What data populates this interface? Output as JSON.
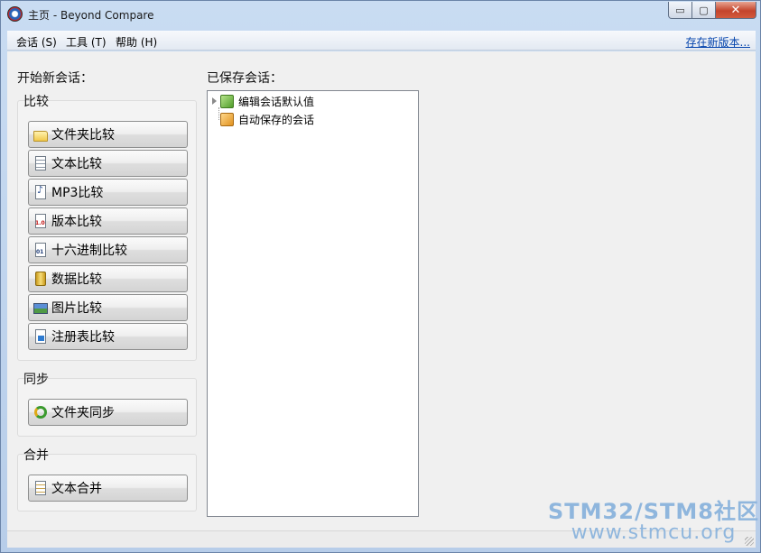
{
  "window": {
    "title": "主页 - Beyond Compare",
    "minimize": "▭",
    "maximize": "▢",
    "close": "✕"
  },
  "menu": {
    "items": [
      "会话 (S)",
      "工具 (T)",
      "帮助 (H)"
    ],
    "update_link": "存在新版本..."
  },
  "new_session": {
    "heading": "开始新会话：",
    "groups": [
      {
        "title": "比较",
        "buttons": [
          {
            "label": "文件夹比较",
            "icon": "folder-icon"
          },
          {
            "label": "文本比较",
            "icon": "text-document-icon"
          },
          {
            "label": "MP3比较",
            "icon": "music-file-icon"
          },
          {
            "label": "版本比较",
            "icon": "version-file-icon"
          },
          {
            "label": "十六进制比较",
            "icon": "hex-file-icon"
          },
          {
            "label": "数据比较",
            "icon": "database-icon"
          },
          {
            "label": "图片比较",
            "icon": "picture-icon"
          },
          {
            "label": "注册表比较",
            "icon": "registry-icon"
          }
        ]
      },
      {
        "title": "同步",
        "buttons": [
          {
            "label": "文件夹同步",
            "icon": "sync-icon"
          }
        ]
      },
      {
        "title": "合并",
        "buttons": [
          {
            "label": "文本合并",
            "icon": "merge-icon"
          }
        ]
      }
    ]
  },
  "saved_sessions": {
    "heading": "已保存会话：",
    "tree": [
      {
        "label": "编辑会话默认值",
        "icon": "green-cube-icon",
        "expandable": true
      },
      {
        "label": "自动保存的会话",
        "icon": "orange-cube-icon",
        "expandable": false
      }
    ]
  },
  "watermark": {
    "brand": "STM32/STM8社区",
    "url": "www.stmcu.org"
  },
  "colors": {
    "link": "#0645ad",
    "watermark": "#8fb6dd",
    "frame": "#b7cde9"
  }
}
